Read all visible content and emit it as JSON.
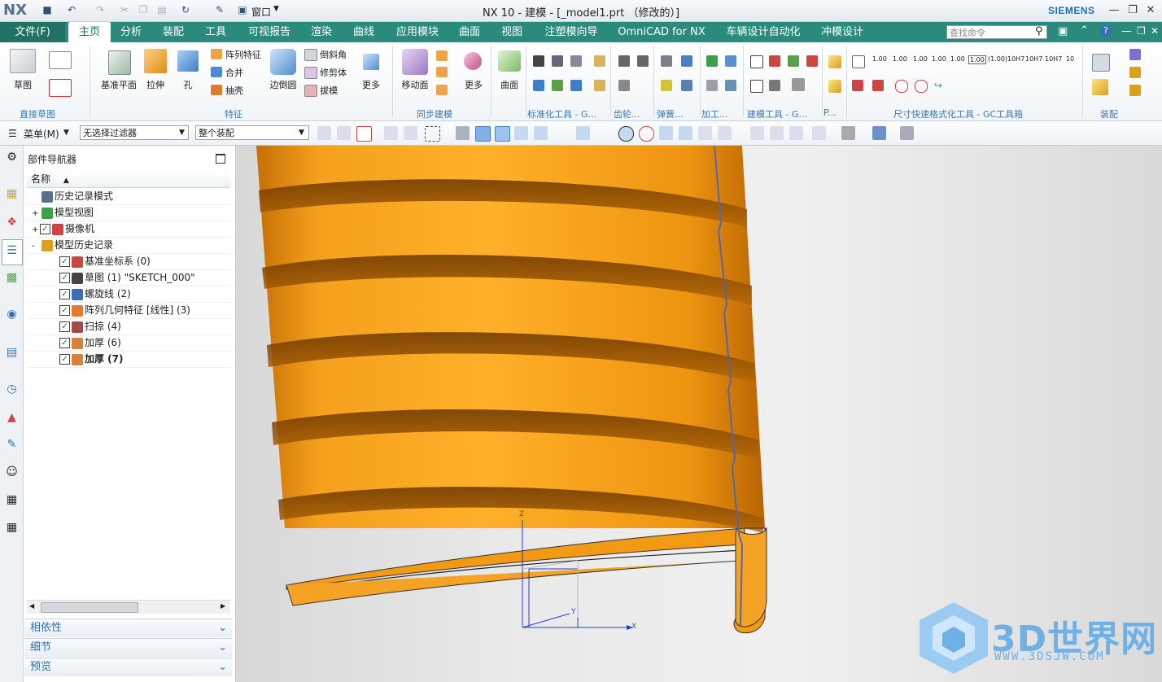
{
  "window": {
    "app_logo": "NX",
    "title": "NX 10 - 建模 - [_model1.prt （修改的）]",
    "brand": "SIEMENS",
    "window_menu": "窗口"
  },
  "tabs": [
    {
      "label": "文件(F)"
    },
    {
      "label": "主页"
    },
    {
      "label": "分析"
    },
    {
      "label": "装配"
    },
    {
      "label": "工具"
    },
    {
      "label": "可视报告"
    },
    {
      "label": "渲染"
    },
    {
      "label": "曲线"
    },
    {
      "label": "应用模块"
    },
    {
      "label": "曲面"
    },
    {
      "label": "视图"
    },
    {
      "label": "注塑模向导"
    },
    {
      "label": "OmniCAD for NX"
    },
    {
      "label": "车辆设计自动化"
    },
    {
      "label": "冲模设计"
    }
  ],
  "search": {
    "placeholder": "查找命令"
  },
  "ribbon": {
    "sketch": "草图",
    "datum_plane": "基准平面",
    "extrude": "拉伸",
    "hole": "孔",
    "pattern_feature": "阵列特征",
    "unite": "合并",
    "shell": "抽壳",
    "edge_blend": "边倒圆",
    "chamfer": "倒斜角",
    "trim_body": "修剪体",
    "draft": "拔模",
    "more1": "更多",
    "move_face": "移动面",
    "more2": "更多",
    "surface": "曲面",
    "groups": {
      "direct_sketch": "直接草图",
      "feature": "特征",
      "sync_modeling": "同步建模",
      "std_tools": "标准化工具 - G...",
      "gear": "齿轮...",
      "spring": "弹簧...",
      "machining": "加工...",
      "build_tools": "建模工具 - G...",
      "more_p": "P...",
      "dim_tools": "尺寸快速格式化工具 - GC工具箱",
      "assembly": "装配"
    },
    "dim_fmt_labels": [
      "1.00",
      "1.00",
      "1.00",
      "1.00",
      "1.00",
      "1.00",
      "(1.00)",
      "10H7",
      "10H7",
      "10H7",
      "10"
    ]
  },
  "toolbar": {
    "menu": "菜单(M)",
    "filter": "无选择过滤器",
    "scope": "整个装配"
  },
  "navigator": {
    "title": "部件导航器",
    "column": "名称",
    "rows": [
      {
        "label": "历史记录模式",
        "level": 0,
        "check": false,
        "expand": ""
      },
      {
        "label": "模型视图",
        "level": 0,
        "check": false,
        "expand": "+"
      },
      {
        "label": "摄像机",
        "level": 0,
        "check": true,
        "expand": "+"
      },
      {
        "label": "模型历史记录",
        "level": 0,
        "check": false,
        "expand": "-"
      },
      {
        "label": "基准坐标系 (0)",
        "level": 1,
        "check": true,
        "expand": ""
      },
      {
        "label": "草图 (1) \"SKETCH_000\"",
        "level": 1,
        "check": true,
        "expand": ""
      },
      {
        "label": "螺旋线 (2)",
        "level": 1,
        "check": true,
        "expand": ""
      },
      {
        "label": "阵列几何特征 [线性] (3)",
        "level": 1,
        "check": true,
        "expand": ""
      },
      {
        "label": "扫掠 (4)",
        "level": 1,
        "check": true,
        "expand": ""
      },
      {
        "label": "加厚 (6)",
        "level": 1,
        "check": true,
        "expand": ""
      },
      {
        "label": "加厚 (7)",
        "level": 1,
        "check": true,
        "expand": "",
        "bold": true
      }
    ],
    "accordions": [
      "相依性",
      "细节",
      "预览"
    ]
  },
  "viewport": {
    "axis_z": "Z",
    "axis_y": "Y",
    "axis_x": "X",
    "watermark_text": "3D世界网",
    "watermark_url": "WWW.3DSJW.COM",
    "body_color": "#f29a14"
  }
}
